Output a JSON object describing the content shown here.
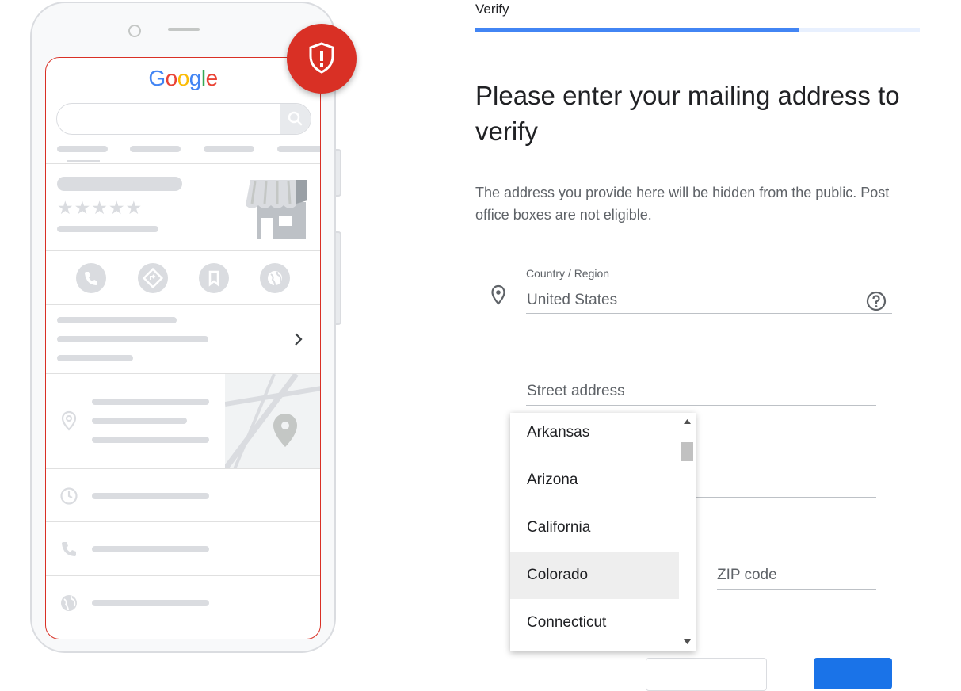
{
  "brand": {
    "logo_text": "Google",
    "logo_colors": [
      "#4285F4",
      "#EA4335",
      "#FBBC05",
      "#4285F4",
      "#34A853",
      "#EA4335"
    ]
  },
  "colors": {
    "accent": "#4285f4",
    "alert": "#d93025",
    "primary_button": "#1a73e8"
  },
  "header": {
    "step_title": "Verify",
    "progress_fraction": 0.73
  },
  "main": {
    "heading": "Please enter your mailing address to verify",
    "description": "The address you provide here will be hidden from the public. Post office boxes are not eligible."
  },
  "form": {
    "country_label": "Country / Region",
    "country_value": "United States",
    "street_placeholder": "Street address",
    "zip_placeholder": "ZIP code"
  },
  "state_dropdown": {
    "options": [
      "Arkansas",
      "Arizona",
      "California",
      "Colorado",
      "Connecticut"
    ],
    "highlighted": "Colorado"
  },
  "icons": {
    "alert": "shield-alert-icon",
    "location": "location-pin-icon",
    "help": "help-circle-icon",
    "scroll_up": "scroll-up-arrow-icon",
    "scroll_down": "scroll-down-arrow-icon"
  },
  "illustration": {
    "rating_stars": "★★★★★"
  }
}
